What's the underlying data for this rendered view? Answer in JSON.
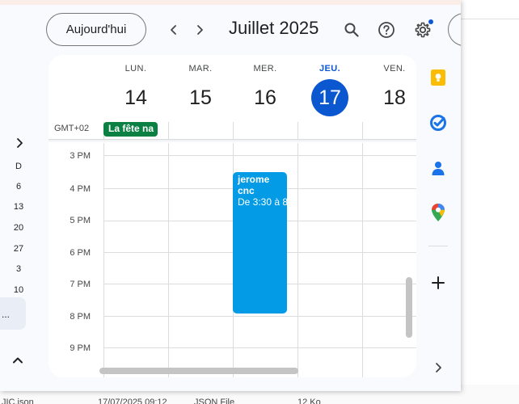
{
  "header": {
    "today_label": "Aujourd'hui",
    "month_title": "Juillet 2025"
  },
  "week": {
    "days": [
      {
        "dow": "LUN.",
        "num": "14",
        "today": false
      },
      {
        "dow": "MAR.",
        "num": "15",
        "today": false
      },
      {
        "dow": "MER.",
        "num": "16",
        "today": false
      },
      {
        "dow": "JEU.",
        "num": "17",
        "today": true
      },
      {
        "dow": "VEN.",
        "num": "18",
        "today": false
      }
    ],
    "timezone": "GMT+02"
  },
  "allday_event": {
    "label": "La fête na"
  },
  "hours": [
    "3 PM",
    "4 PM",
    "5 PM",
    "6 PM",
    "7 PM",
    "8 PM",
    "9 PM"
  ],
  "event": {
    "title": "jerome",
    "subtitle": "cnc",
    "time": "De 3:30 à 8"
  },
  "mini_calendar": {
    "labels": [
      "D",
      "6",
      "13",
      "20",
      "27",
      "3",
      "10"
    ],
    "selected": "..."
  },
  "behind_window": {
    "file_name": "JIC.json",
    "date": "17/07/2025 09:12",
    "type": "JSON File",
    "size": "12 Ko"
  },
  "colors": {
    "accent": "#0b57d0",
    "event": "#039be5",
    "allday_event": "#0b8043"
  }
}
